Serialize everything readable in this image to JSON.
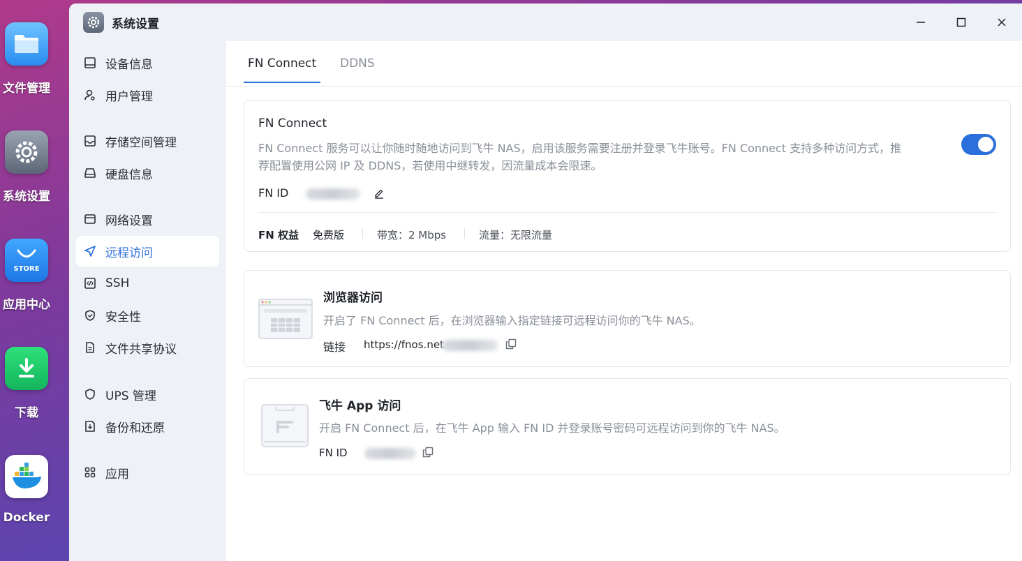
{
  "dock": {
    "files": "文件管理",
    "settings": "系统设置",
    "store": "应用中心",
    "store_badge": "STORE",
    "download": "下载",
    "docker": "Docker"
  },
  "window": {
    "title": "系统设置"
  },
  "sidebar": {
    "items": [
      {
        "label": "设备信息",
        "icon": "monitor-icon"
      },
      {
        "label": "用户管理",
        "icon": "user-gear-icon"
      },
      {
        "label": "存储空间管理",
        "icon": "storage-icon"
      },
      {
        "label": "硬盘信息",
        "icon": "hard-drive-icon"
      },
      {
        "label": "网络设置",
        "icon": "network-icon"
      },
      {
        "label": "远程访问",
        "icon": "send-icon",
        "active": true
      },
      {
        "label": "SSH",
        "icon": "code-icon"
      },
      {
        "label": "安全性",
        "icon": "shield-check-icon"
      },
      {
        "label": "文件共享协议",
        "icon": "document-icon"
      },
      {
        "label": "UPS 管理",
        "icon": "shield-icon"
      },
      {
        "label": "备份和还原",
        "icon": "backup-icon"
      },
      {
        "label": "应用",
        "icon": "apps-grid-icon"
      }
    ]
  },
  "tabs": [
    {
      "label": "FN Connect",
      "active": true
    },
    {
      "label": "DDNS",
      "active": false
    }
  ],
  "fn_connect": {
    "title": "FN Connect",
    "description_line1": "FN Connect 服务可以让你随时随地访问到飞牛 NAS，启用该服务需要注册并登录飞牛账号。FN Connect 支持多种访问方式，推",
    "description_line2": "荐配置使用公网 IP 及 DDNS，若使用中继转发，因流量成本会限速。",
    "enabled": true,
    "fn_id_label": "FN ID",
    "rights_label": "FN 权益",
    "plan": "免费版",
    "bandwidth": "带宽：2 Mbps",
    "traffic": "流量：无限流量"
  },
  "browser_access": {
    "title": "浏览器访问",
    "description": "开启了 FN Connect 后，在浏览器输入指定链接可远程访问你的飞牛 NAS。",
    "link_label": "链接",
    "link_value": "https://fnos.net"
  },
  "app_access": {
    "title": "飞牛 App 访问",
    "description": "开启 FN Connect 后，在飞牛 App 输入 FN ID 并登录账号密码可远程访问到你的飞牛 NAS。",
    "fn_id_label": "FN ID"
  },
  "colors": {
    "accent": "#2a6fdb",
    "sidebar_bg": "#eef1f6",
    "muted_text": "#8a9099"
  }
}
